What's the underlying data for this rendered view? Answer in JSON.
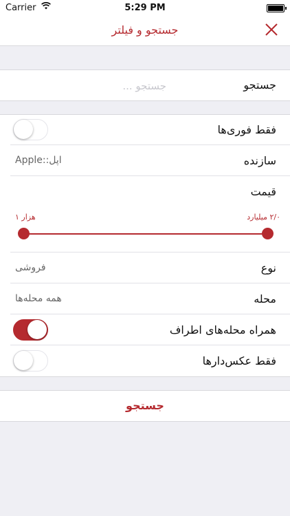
{
  "status_bar": {
    "carrier": "Carrier",
    "time": "5:29 PM"
  },
  "nav": {
    "title": "جستجو و فیلتر",
    "close_icon": "close-x-icon"
  },
  "search": {
    "label": "جستجو",
    "placeholder": "جستجو ...",
    "value": ""
  },
  "instant_only": {
    "label": "فقط فوری‌ها",
    "on": false
  },
  "maker": {
    "label": "سازنده",
    "value": "Apple::اپل"
  },
  "price": {
    "label": "قیمت",
    "min_label": "۱ هزار",
    "max_label": "۲/۰ میلیارد"
  },
  "type": {
    "label": "نوع",
    "value": "فروشی"
  },
  "neighborhood": {
    "label": "محله",
    "value": "همه محله‌ها"
  },
  "with_nearby": {
    "label": "همراه محله‌های اطراف",
    "on": true
  },
  "photos_only": {
    "label": "فقط عکس‌دارها",
    "on": false
  },
  "submit": {
    "label": "جستجو"
  },
  "colors": {
    "accent": "#b52a2f",
    "background": "#efeff4"
  }
}
